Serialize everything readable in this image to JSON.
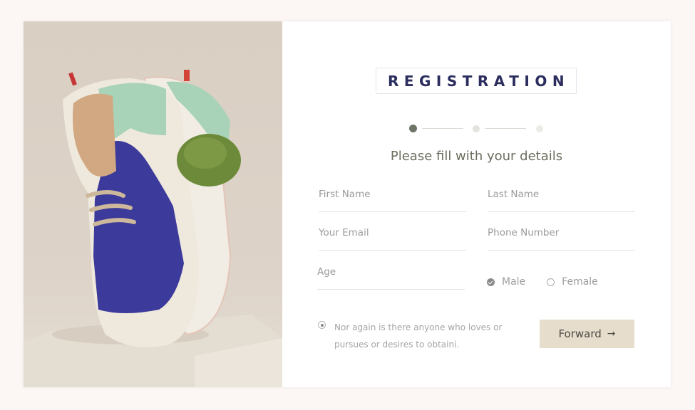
{
  "registration": {
    "title": "REGISTRATION",
    "subtitle": "Please fill with your details",
    "steps": {
      "total": 3,
      "current": 1
    },
    "fields": {
      "first_name": {
        "placeholder": "First Name",
        "value": ""
      },
      "last_name": {
        "placeholder": "Last Name",
        "value": ""
      },
      "email": {
        "placeholder": "Your Email",
        "value": ""
      },
      "phone": {
        "placeholder": "Phone Number",
        "value": ""
      },
      "age": {
        "placeholder": "Age",
        "value": ""
      }
    },
    "gender": {
      "options": [
        {
          "label": "Male",
          "selected": true
        },
        {
          "label": "Female",
          "selected": false
        }
      ]
    },
    "agreement_text": "Nor again is there anyone who loves or pursues or desires to obtaini.",
    "forward_button": {
      "label": "Forward",
      "icon": "arrow-right-icon",
      "glyph": "→"
    }
  },
  "image": {
    "alt": "Sneaker with cactus product photo"
  },
  "colors": {
    "background": "#fcf6f4",
    "title": "#2b2d5e",
    "subtitle": "#6b6f5f",
    "step_active": "#6f7566",
    "button_bg": "#e6ddcd"
  }
}
